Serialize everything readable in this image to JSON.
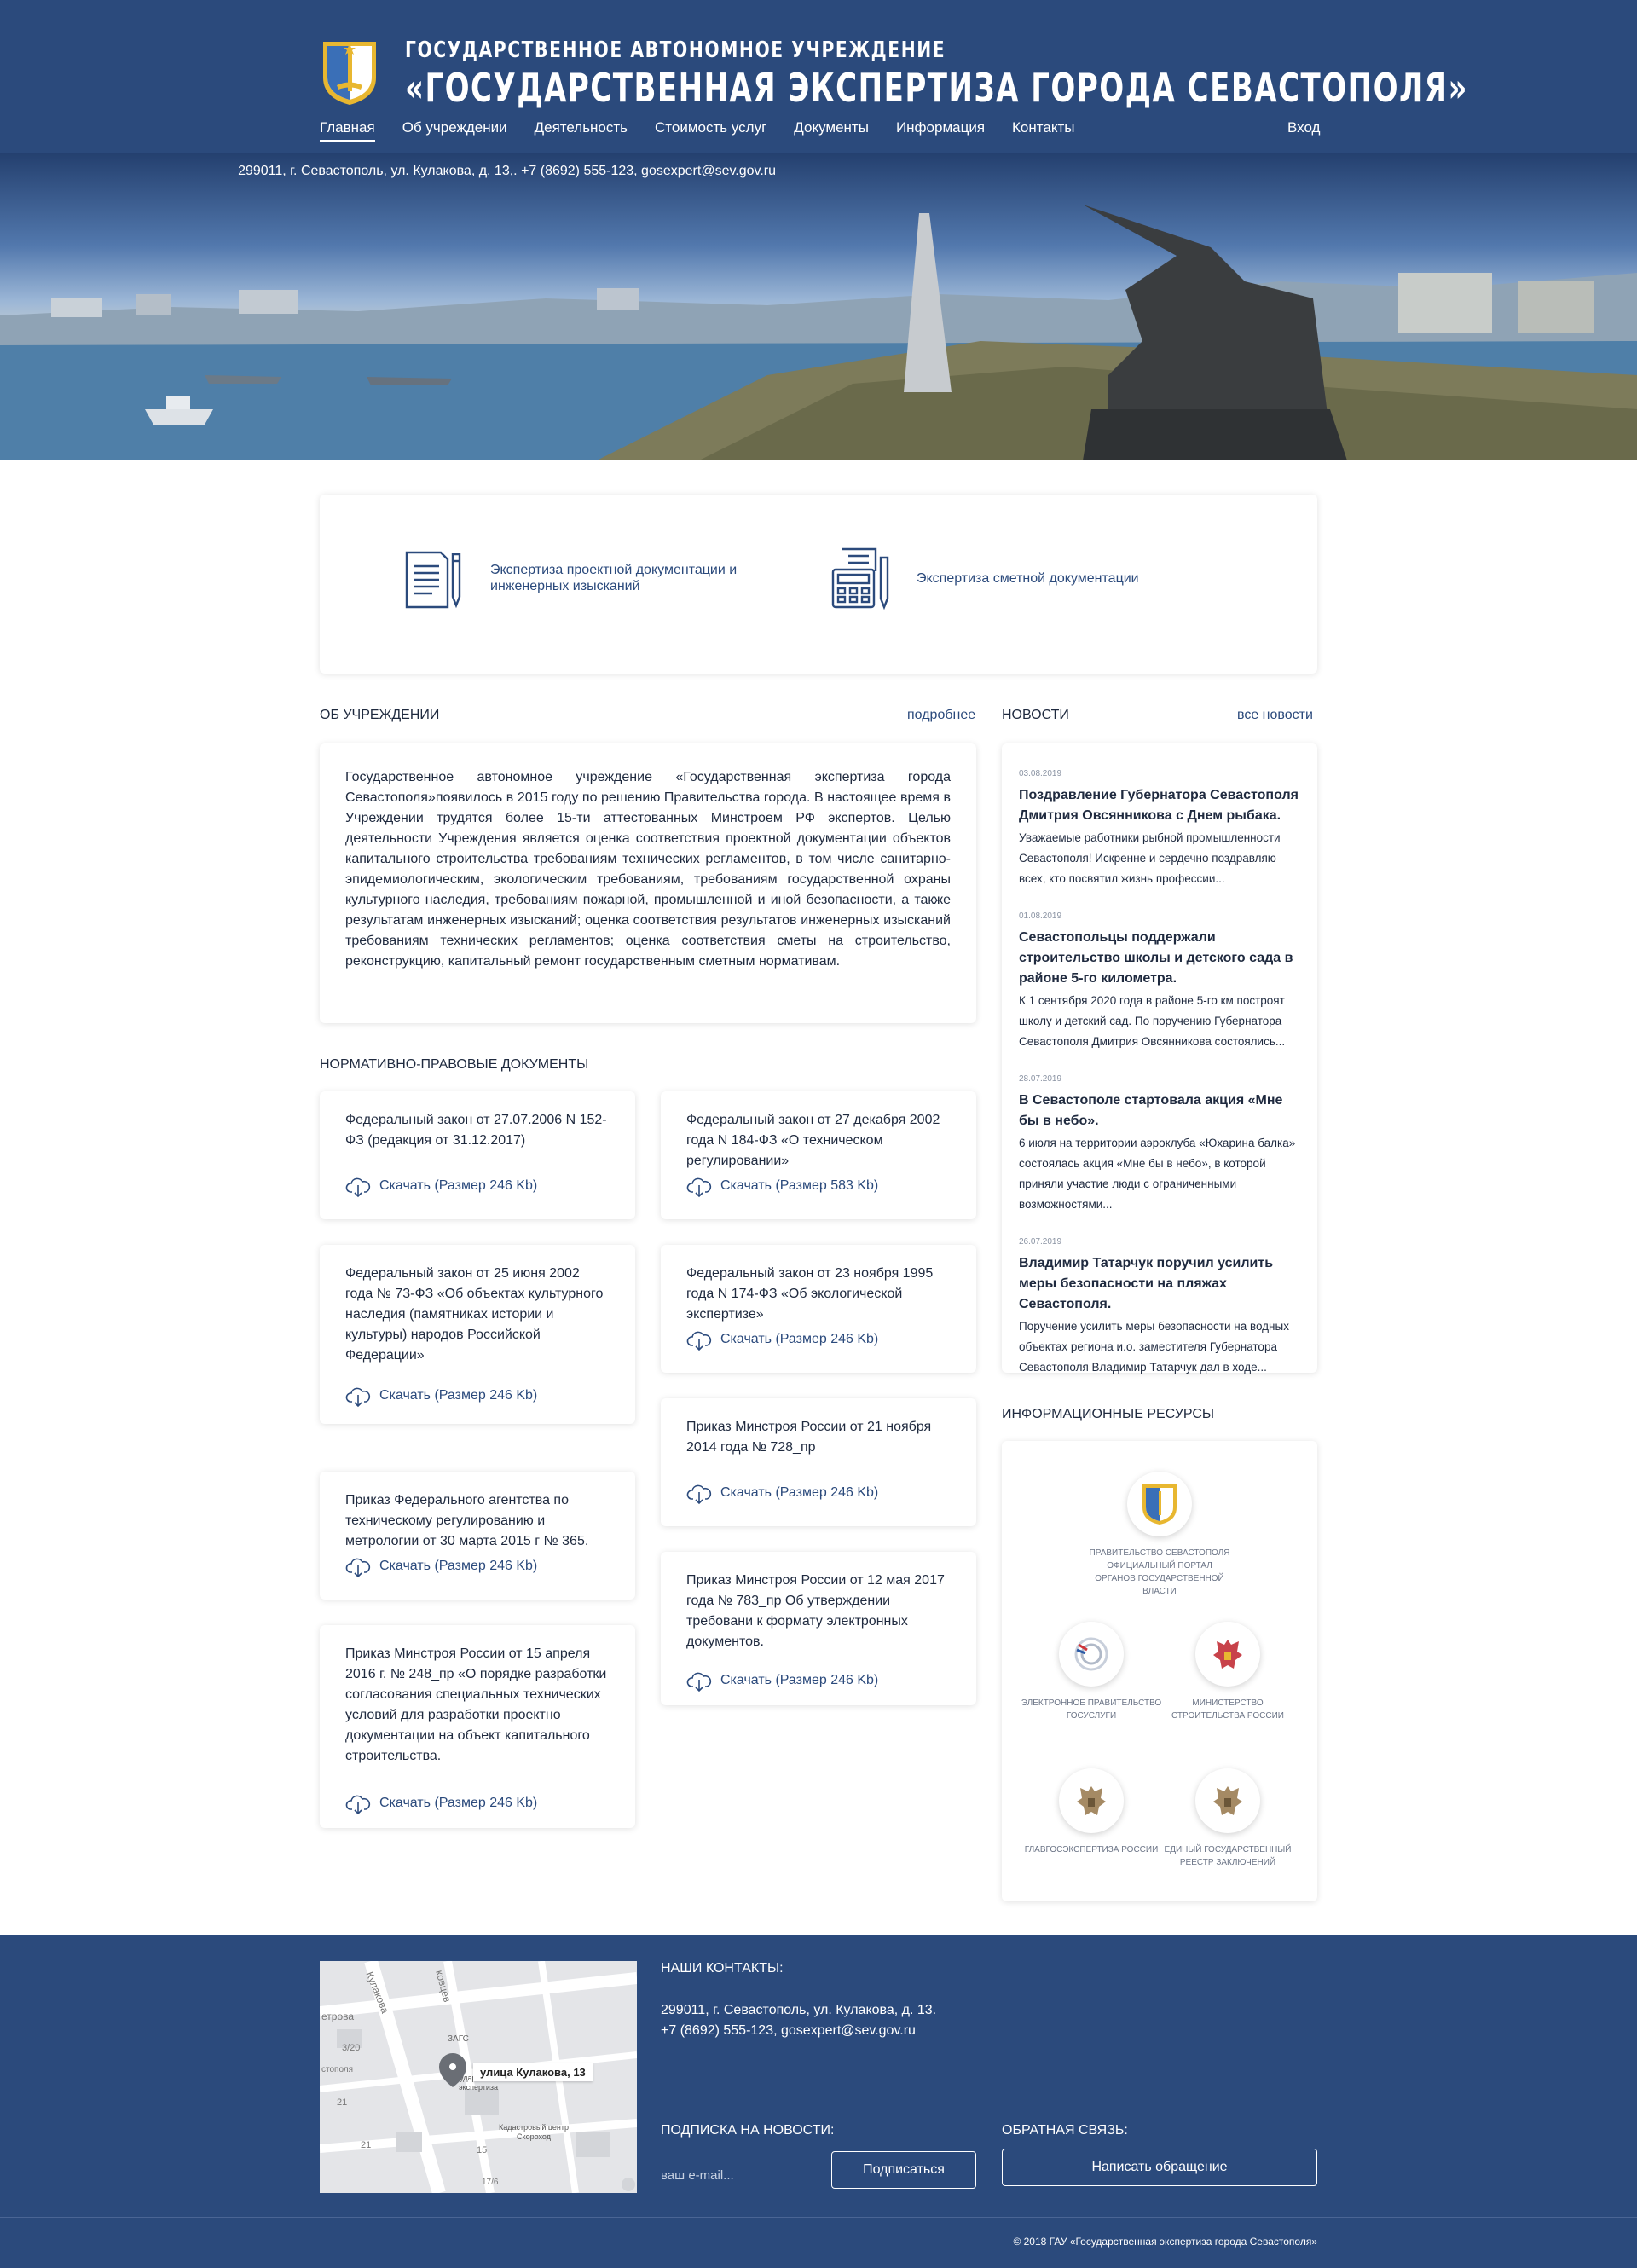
{
  "header": {
    "org_type": "ГОСУДАРСТВЕННОЕ АВТОНОМНОЕ УЧРЕЖДЕНИЕ",
    "org_name": "«ГОСУДАРСТВЕННАЯ ЭКСПЕРТИЗА ГОРОДА СЕВАСТОПОЛЯ»",
    "nav": [
      "Главная",
      "Об учреждении",
      "Деятельность",
      "Стоимость услуг",
      "Документы",
      "Информация",
      "Контакты"
    ],
    "login": "Вход"
  },
  "hero": {
    "address": "299011, г. Севастополь, ул. Кулакова, д. 13,. +7 (8692) 555-123, gosexpert@sev.gov.ru"
  },
  "services": [
    {
      "label": "Экспертиза проектной документации и инженерных изысканий",
      "icon": "document-pen-icon"
    },
    {
      "label": "Экспертиза сметной документации",
      "icon": "calculator-icon"
    }
  ],
  "about": {
    "title": "ОБ УЧРЕЖДЕНИИ",
    "more": "подробнее",
    "text": "Государственное автономное учреждение «Государственная экспертиза города Севастополя»появилось в 2015 году по решению Правительства города. В настоящее время в Учреждении трудятся более 15-ти аттестованных Минстроем РФ экспертов. Целью деятельности Учреждения является оценка соответствия проектной документации объектов капитального строительства требованиям технических регламентов, в том числе санитарно-эпидемиологическим, экологическим требованиям, требованиям государственной охраны культурного наследия, требованиям пожарной, промышленной и иной безопасности, а также результатам инженерных изысканий; оценка соответствия результатов инженерных изысканий требованиям технических регламентов; оценка соответствия сметы на строительство, реконструкцию, капитальный ремонт государственным сметным нормативам."
  },
  "docs": {
    "title": "НОРМАТИВНО-ПРАВОВЫЕ ДОКУМЕНТЫ",
    "items": [
      {
        "title": "Федеральный закон от 27.07.2006 N 152-ФЗ (редакция от 31.12.2017)",
        "download": "Скачать (Размер 246 Kb)"
      },
      {
        "title": "Федеральный закон от 27 декабря 2002 года N 184-ФЗ «О техническом регулировании»",
        "download": "Скачать (Размер 583 Kb)"
      },
      {
        "title": "Федеральный закон от 25 июня 2002 года № 73-ФЗ «Об объектах культурного наследия (памятниках истории и культуры) народов Российской Федерации»",
        "download": "Скачать (Размер 246 Kb)"
      },
      {
        "title": "Федеральный закон от 23 ноября 1995 года N 174-ФЗ «Об экологической экспертизе»",
        "download": "Скачать (Размер 246 Kb)"
      },
      {
        "title": "Приказ Минстроя России от 21 ноября 2014 года № 728_пр",
        "download": "Скачать (Размер 246 Kb)"
      },
      {
        "title": "Приказ Федерального агентства по техническому регулированию и метрологии от 30 марта 2015 г № 365.",
        "download": "Скачать (Размер 246 Kb)"
      },
      {
        "title": "Приказ Минстроя России от 12 мая 2017 года № 783_пр Об утверждении требовани к формату электронных документов.",
        "download": "Скачать (Размер 246 Kb)"
      },
      {
        "title": "Приказ Минстроя России от 15 апреля 2016 г. № 248_пр «О порядке разработки согласования специальных технических условий для разработки проектно документации на объект капитального строительства.",
        "download": "Скачать (Размер 246 Kb)"
      }
    ]
  },
  "news": {
    "title": "НОВОСТИ",
    "all": "все новости",
    "items": [
      {
        "date": "03.08.2019",
        "head": "Поздравление Губернатора Севастополя Дмитрия Овсянникова с Днем рыбака.",
        "text": "Уважаемые работники рыбной промышленности Севастополя! Искренне и сердечно поздравляю всех, кто посвятил жизнь профессии..."
      },
      {
        "date": "01.08.2019",
        "head": "Севастопольцы поддержали строительство школы и детского сада в районе 5-го километра.",
        "text": "К 1 сентября 2020 года в районе 5-го км построят школу и детский сад. По поручению Губернатора Севастополя Дмитрия Овсянникова состоялись..."
      },
      {
        "date": "28.07.2019",
        "head": "В Севастополе стартовала акция «Мне бы в небо».",
        "text": "6 июля на территории аэроклуба «Юхарина балка» состоялась акция «Мне бы в небо», в которой приняли участие люди с ограниченными возможностями..."
      },
      {
        "date": "26.07.2019",
        "head": "Владимир Татарчук поручил усилить меры безопасности на пляжах Севастополя.",
        "text": "Поручение усилить меры безопасности на водных объектах региона и.о. заместителя Губернатора Севастополя Владимир Татарчук дал в ходе..."
      }
    ]
  },
  "resources": {
    "title": "ИНФОРМАЦИОННЫЕ РЕСУРСЫ",
    "items": [
      {
        "label": "Правительство Севастополя официальный портал органов государственной власти",
        "icon": "sevastopol-emblem-icon"
      },
      {
        "label": "Электронное правительство госуслуги",
        "icon": "gosuslugi-icon"
      },
      {
        "label": "Министерство строительства России",
        "icon": "russia-eagle-icon"
      },
      {
        "label": "Главгосэкспертиза России",
        "icon": "glavgosexpertiza-icon"
      },
      {
        "label": "Единый государственный реестр заключений",
        "icon": "egrz-icon"
      }
    ]
  },
  "footer": {
    "map": {
      "street_label": "улица Кулакова, 13",
      "place_label": "Государственная экспертиза",
      "zags": "ЗАГС",
      "cadastral": "Кадастровый центр Скороход",
      "petrova": "етрова",
      "street_vert": "Кулакова",
      "kovtsev": "ковцев",
      "sevastopol": "стополя",
      "n1": "3/20",
      "n2": "21",
      "n3": "15",
      "n4": "21",
      "n5": "17/6"
    },
    "contacts_title": "НАШИ КОНТАКТЫ:",
    "address": "299011, г. Севастополь, ул. Кулакова, д. 13.",
    "phone_email": "+7 (8692) 555-123, gosexpert@sev.gov.ru",
    "subscribe_title": "ПОДПИСКА НА НОВОСТИ:",
    "email_placeholder": "ваш e-mail...",
    "subscribe_button": "Подписаться",
    "feedback_title": "ОБРАТНАЯ СВЯЗЬ:",
    "feedback_button": "Написать обращение",
    "copyright": "© 2018 ГАУ «Государственная экспертиза города Севастополя»"
  }
}
